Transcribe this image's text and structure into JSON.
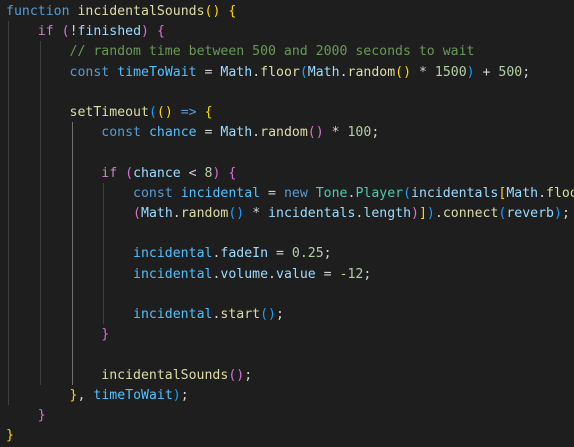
{
  "editor": {
    "language": "javascript",
    "theme_colors": {
      "background": "#1e1e1e",
      "keyword": "#569cd6",
      "control": "#c586c0",
      "function": "#dcdcaa",
      "variable": "#9cdcfe",
      "constant": "#4fc1ff",
      "class": "#4ec9b0",
      "number": "#b5cea8",
      "comment": "#6a9955",
      "text": "#d4d4d4",
      "bracket_1": "#ffd700",
      "bracket_2": "#da70d6",
      "bracket_3": "#179fff"
    },
    "lines": [
      {
        "tokens": [
          {
            "t": "function",
            "c": "kw"
          },
          {
            "t": " ",
            "c": "op"
          },
          {
            "t": "incidentalSounds",
            "c": "fn"
          },
          {
            "t": "()",
            "c": "p1"
          },
          {
            "t": " ",
            "c": "op"
          },
          {
            "t": "{",
            "c": "p1"
          }
        ]
      },
      {
        "tokens": [
          {
            "t": "    ",
            "c": "op"
          },
          {
            "t": "if",
            "c": "ctl"
          },
          {
            "t": " ",
            "c": "op"
          },
          {
            "t": "(",
            "c": "p2"
          },
          {
            "t": "!",
            "c": "op"
          },
          {
            "t": "finished",
            "c": "var"
          },
          {
            "t": ")",
            "c": "p2"
          },
          {
            "t": " ",
            "c": "op"
          },
          {
            "t": "{",
            "c": "p2"
          }
        ]
      },
      {
        "tokens": [
          {
            "t": "        ",
            "c": "op"
          },
          {
            "t": "// random time between 500 and 2000 seconds to wait",
            "c": "cmt"
          }
        ]
      },
      {
        "tokens": [
          {
            "t": "        ",
            "c": "op"
          },
          {
            "t": "const",
            "c": "kw"
          },
          {
            "t": " ",
            "c": "op"
          },
          {
            "t": "timeToWait",
            "c": "const"
          },
          {
            "t": " = ",
            "c": "op"
          },
          {
            "t": "Math",
            "c": "var"
          },
          {
            "t": ".",
            "c": "op"
          },
          {
            "t": "floor",
            "c": "fn"
          },
          {
            "t": "(",
            "c": "p3"
          },
          {
            "t": "Math",
            "c": "var"
          },
          {
            "t": ".",
            "c": "op"
          },
          {
            "t": "random",
            "c": "fn"
          },
          {
            "t": "()",
            "c": "p1"
          },
          {
            "t": " * ",
            "c": "op"
          },
          {
            "t": "1500",
            "c": "num"
          },
          {
            "t": ")",
            "c": "p3"
          },
          {
            "t": " + ",
            "c": "op"
          },
          {
            "t": "500",
            "c": "num"
          },
          {
            "t": ";",
            "c": "op"
          }
        ]
      },
      {
        "tokens": []
      },
      {
        "tokens": [
          {
            "t": "        ",
            "c": "op"
          },
          {
            "t": "setTimeout",
            "c": "fn"
          },
          {
            "t": "(",
            "c": "p3"
          },
          {
            "t": "()",
            "c": "p1"
          },
          {
            "t": " ",
            "c": "op"
          },
          {
            "t": "=>",
            "c": "kw"
          },
          {
            "t": " ",
            "c": "op"
          },
          {
            "t": "{",
            "c": "p1"
          }
        ]
      },
      {
        "tokens": [
          {
            "t": "            ",
            "c": "op"
          },
          {
            "t": "const",
            "c": "kw"
          },
          {
            "t": " ",
            "c": "op"
          },
          {
            "t": "chance",
            "c": "const"
          },
          {
            "t": " = ",
            "c": "op"
          },
          {
            "t": "Math",
            "c": "var"
          },
          {
            "t": ".",
            "c": "op"
          },
          {
            "t": "random",
            "c": "fn"
          },
          {
            "t": "()",
            "c": "p2"
          },
          {
            "t": " * ",
            "c": "op"
          },
          {
            "t": "100",
            "c": "num"
          },
          {
            "t": ";",
            "c": "op"
          }
        ]
      },
      {
        "tokens": []
      },
      {
        "tokens": [
          {
            "t": "            ",
            "c": "op"
          },
          {
            "t": "if",
            "c": "ctl"
          },
          {
            "t": " ",
            "c": "op"
          },
          {
            "t": "(",
            "c": "p2"
          },
          {
            "t": "chance",
            "c": "var"
          },
          {
            "t": " < ",
            "c": "op"
          },
          {
            "t": "8",
            "c": "num"
          },
          {
            "t": ")",
            "c": "p2"
          },
          {
            "t": " ",
            "c": "op"
          },
          {
            "t": "{",
            "c": "p2"
          }
        ]
      },
      {
        "tokens": [
          {
            "t": "                ",
            "c": "op"
          },
          {
            "t": "const",
            "c": "kw"
          },
          {
            "t": " ",
            "c": "op"
          },
          {
            "t": "incidental",
            "c": "const"
          },
          {
            "t": " = ",
            "c": "op"
          },
          {
            "t": "new",
            "c": "kw"
          },
          {
            "t": " ",
            "c": "op"
          },
          {
            "t": "Tone",
            "c": "cls"
          },
          {
            "t": ".",
            "c": "op"
          },
          {
            "t": "Player",
            "c": "cls"
          },
          {
            "t": "(",
            "c": "p3"
          },
          {
            "t": "incidentals",
            "c": "var"
          },
          {
            "t": "[",
            "c": "p1"
          },
          {
            "t": "Math",
            "c": "var"
          },
          {
            "t": ".",
            "c": "op"
          },
          {
            "t": "floor",
            "c": "fn"
          }
        ]
      },
      {
        "tokens": [
          {
            "t": "                ",
            "c": "op"
          },
          {
            "t": "(",
            "c": "p2"
          },
          {
            "t": "Math",
            "c": "var"
          },
          {
            "t": ".",
            "c": "op"
          },
          {
            "t": "random",
            "c": "fn"
          },
          {
            "t": "()",
            "c": "p3"
          },
          {
            "t": " * ",
            "c": "op"
          },
          {
            "t": "incidentals",
            "c": "var"
          },
          {
            "t": ".",
            "c": "op"
          },
          {
            "t": "length",
            "c": "var"
          },
          {
            "t": ")",
            "c": "p2"
          },
          {
            "t": "]",
            "c": "p1"
          },
          {
            "t": ")",
            "c": "p3"
          },
          {
            "t": ".",
            "c": "op"
          },
          {
            "t": "connect",
            "c": "fn"
          },
          {
            "t": "(",
            "c": "p3"
          },
          {
            "t": "reverb",
            "c": "var"
          },
          {
            "t": ")",
            "c": "p3"
          },
          {
            "t": ";",
            "c": "op"
          }
        ]
      },
      {
        "tokens": []
      },
      {
        "tokens": [
          {
            "t": "                ",
            "c": "op"
          },
          {
            "t": "incidental",
            "c": "const"
          },
          {
            "t": ".",
            "c": "op"
          },
          {
            "t": "fadeIn",
            "c": "var"
          },
          {
            "t": " = ",
            "c": "op"
          },
          {
            "t": "0.25",
            "c": "num"
          },
          {
            "t": ";",
            "c": "op"
          }
        ]
      },
      {
        "tokens": [
          {
            "t": "                ",
            "c": "op"
          },
          {
            "t": "incidental",
            "c": "const"
          },
          {
            "t": ".",
            "c": "op"
          },
          {
            "t": "volume",
            "c": "var"
          },
          {
            "t": ".",
            "c": "op"
          },
          {
            "t": "value",
            "c": "var"
          },
          {
            "t": " = ",
            "c": "op"
          },
          {
            "t": "-12",
            "c": "num"
          },
          {
            "t": ";",
            "c": "op"
          }
        ]
      },
      {
        "tokens": []
      },
      {
        "tokens": [
          {
            "t": "                ",
            "c": "op"
          },
          {
            "t": "incidental",
            "c": "const"
          },
          {
            "t": ".",
            "c": "op"
          },
          {
            "t": "start",
            "c": "fn"
          },
          {
            "t": "()",
            "c": "p3"
          },
          {
            "t": ";",
            "c": "op"
          }
        ]
      },
      {
        "tokens": [
          {
            "t": "            ",
            "c": "op"
          },
          {
            "t": "}",
            "c": "p2"
          }
        ]
      },
      {
        "tokens": []
      },
      {
        "tokens": [
          {
            "t": "            ",
            "c": "op"
          },
          {
            "t": "incidentalSounds",
            "c": "fn"
          },
          {
            "t": "()",
            "c": "p2"
          },
          {
            "t": ";",
            "c": "op"
          }
        ]
      },
      {
        "tokens": [
          {
            "t": "        ",
            "c": "op"
          },
          {
            "t": "}",
            "c": "p1"
          },
          {
            "t": ", ",
            "c": "op"
          },
          {
            "t": "timeToWait",
            "c": "const"
          },
          {
            "t": ")",
            "c": "p3"
          },
          {
            "t": ";",
            "c": "op"
          }
        ]
      },
      {
        "tokens": [
          {
            "t": "    ",
            "c": "op"
          },
          {
            "t": "}",
            "c": "p2"
          }
        ]
      },
      {
        "tokens": [
          {
            "t": "}",
            "c": "p1"
          }
        ]
      }
    ]
  }
}
